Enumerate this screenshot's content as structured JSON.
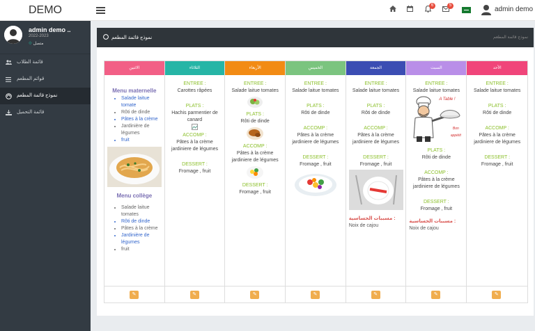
{
  "header": {
    "brand": "DEMO",
    "notif_count": "6",
    "mail_count": "5",
    "admin_name": "admin demo ..."
  },
  "sidebar": {
    "user_name": "admin demo ..",
    "user_year": "2022-2023",
    "user_status": "متصل",
    "items": [
      {
        "label": "قائمة الطلاب",
        "icon": "users-icon"
      },
      {
        "label": "قوائم المطعم",
        "icon": "list-icon"
      },
      {
        "label": "نموذج قائمة المطعم",
        "icon": "chef-hat-icon"
      },
      {
        "label": "قائمة التحميل",
        "icon": "download-icon"
      }
    ]
  },
  "panel": {
    "title": "نموذج قائمة المطعم",
    "crumb": "نموذج قائمة المطعم"
  },
  "columns": [
    {
      "day": "الاثنين",
      "color": "#f25f86",
      "maternelle_title": "Menu maternelle",
      "maternelle": [
        "Salade laitue tomate",
        "Rôti de dinde",
        "Pâtes à la crème",
        "Jardinière de légumes",
        "fruit"
      ],
      "college_title": "Menu collège",
      "college": [
        "Salade laitue tomates",
        "Rôti de dinde",
        "Pâtes à la crème",
        "Jardinière de légumes",
        "fruit"
      ]
    },
    {
      "day": "الثلاثاء",
      "color": "#26b5a6",
      "entree_label": "ENTREE :",
      "entree": "Carottes râpées",
      "plats_label": "PLATS :",
      "plats": "Hachis parmentier de canard",
      "accomp_label": "ACCOMP :",
      "accomp": "Pâtes à la crème jardiniere de légumes",
      "dessert_label": "DESSERT :",
      "dessert": "Fromage , fruit"
    },
    {
      "day": "الأربعاء",
      "color": "#f28b14",
      "entree_label": "ENTREE :",
      "entree": "Salade laitue tomates",
      "plats_label": "PLATS :",
      "plats": "Rôti de dinde",
      "accomp_label": "ACCOMP :",
      "accomp": "Pâtes à la crème jardiniere de légumes",
      "dessert_label": "DESSERT :",
      "dessert": "Fromage , fruit"
    },
    {
      "day": "الخميس",
      "color": "#7bc47f",
      "entree_label": "ENTREE :",
      "entree": "Salade laitue tomates",
      "plats_label": "PLATS :",
      "plats": "Rôti de dinde",
      "accomp_label": "ACCOMP :",
      "accomp": "Pâtes à la crème jardiniere de légumes",
      "dessert_label": "DESSERT :",
      "dessert": "Fromage , fruit"
    },
    {
      "day": "الجمعة",
      "color": "#3b4db3",
      "entree_label": "ENTREE :",
      "entree": "Salade laitue tomates",
      "plats_label": "PLATS :",
      "plats": "Rôti de dinde",
      "accomp_label": "ACCOMP :",
      "accomp": "Pâtes à la crème jardiniere de légumes",
      "dessert_label": "DESSERT :",
      "dessert": "Fromage , fruit",
      "allergy_label": "مسببات الحساسية :",
      "allergy": "Noix de cajou"
    },
    {
      "day": "السبت",
      "color": "#b98ee8",
      "entree_label": "ENTREE :",
      "entree": "Salade laitue tomates",
      "chef_sign_1": "A Table !",
      "chef_sign_2": "Bon appétit",
      "plats_label": "PLATS :",
      "plats": "Rôti de dinde",
      "accomp_label": "ACCOMP :",
      "accomp": "Pâtes à la crème jardiniere de légumes",
      "dessert_label": "DESSERT :",
      "dessert": "Fromage , fruit",
      "allergy_label": "مسببات الحساسية :",
      "allergy": "Noix de cajou"
    },
    {
      "day": "الأحد",
      "color": "#f0457a",
      "entree_label": "ENTREE :",
      "entree": "Salade laitue tomates",
      "plats_label": "PLATS :",
      "plats": "Rôti de dinde",
      "accomp_label": "ACCOMP :",
      "accomp": "Pâtes à la crème jardiniere de légumes",
      "dessert_label": "DESSERT :",
      "dessert": "Fromage , fruit"
    }
  ],
  "edit_icon": "edit-icon"
}
